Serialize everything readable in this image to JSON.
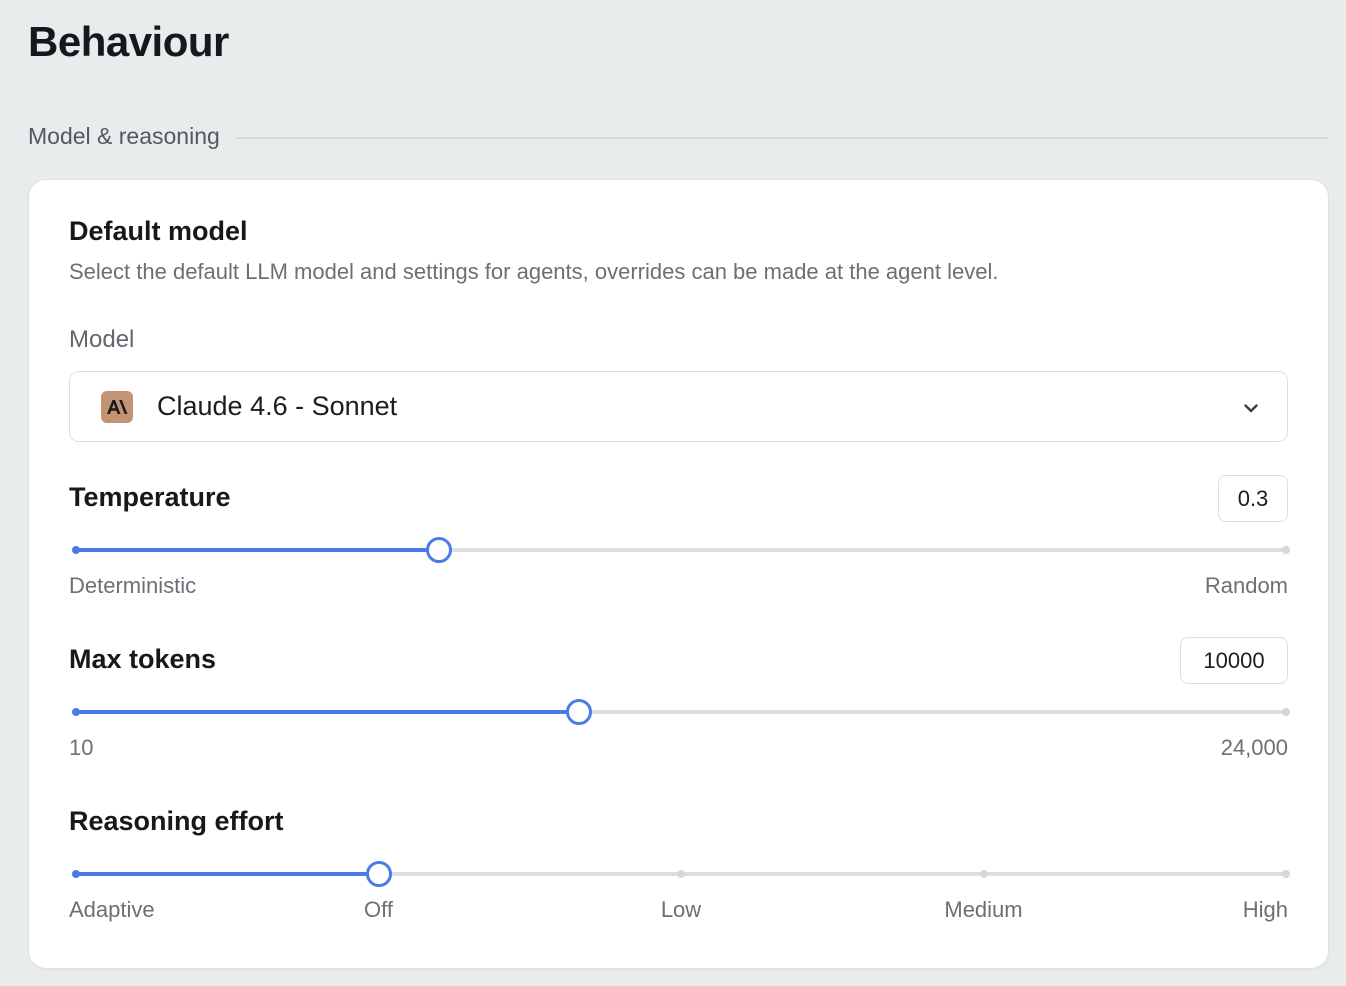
{
  "page": {
    "title": "Behaviour"
  },
  "section": {
    "label": "Model & reasoning"
  },
  "default_model": {
    "title": "Default model",
    "description": "Select the default LLM model and settings for agents, overrides can be made at the agent level.",
    "model_label": "Model",
    "model_value": "Claude 4.6 - Sonnet",
    "model_logo_text": "A\\",
    "model_logo_color": "#c49373",
    "chevron_icon": "chevron-down-icon"
  },
  "temperature": {
    "label": "Temperature",
    "value": "0.3",
    "fraction": 0.3,
    "min_label": "Deterministic",
    "max_label": "Random"
  },
  "max_tokens": {
    "label": "Max tokens",
    "value": "10000",
    "fraction": 0.416,
    "min_label": "10",
    "max_label": "24,000"
  },
  "reasoning_effort": {
    "label": "Reasoning effort",
    "selected_index": 1,
    "options": [
      "Adaptive",
      "Off",
      "Low",
      "Medium",
      "High"
    ]
  },
  "colors": {
    "accent": "#4b7be6",
    "track": "#dcdfe1",
    "background": "#e9ecec"
  }
}
